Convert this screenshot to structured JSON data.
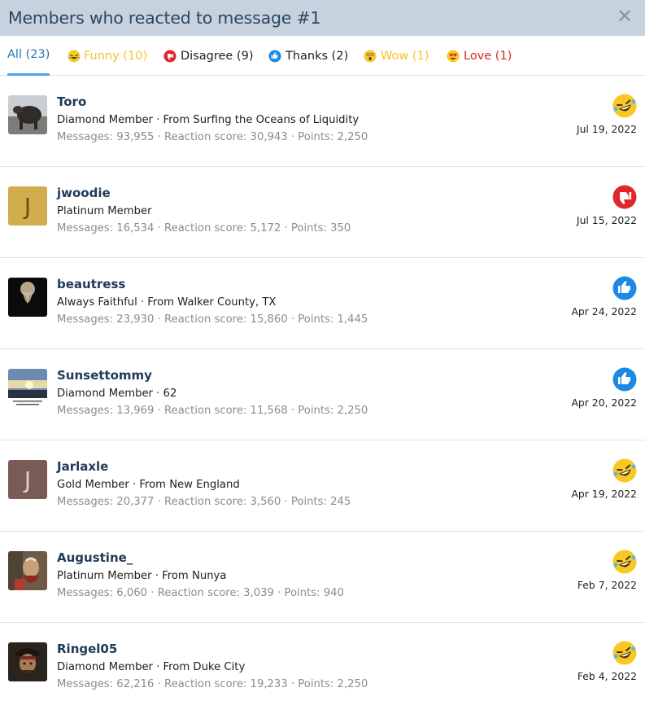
{
  "overlay": {
    "title": "Members who reacted to message #1",
    "close_glyph": "✕"
  },
  "tabs": [
    {
      "label": "All (23)",
      "icon": "",
      "color": "#2577b1"
    },
    {
      "label": "Funny (10)",
      "icon": "funny-icon",
      "color": "#f5c22d"
    },
    {
      "label": "Disagree (9)",
      "icon": "disagree-icon",
      "color": "#1e1e1e"
    },
    {
      "label": "Thanks (2)",
      "icon": "thanks-icon",
      "color": "#1e1e1e"
    },
    {
      "label": "Wow (1)",
      "icon": "wow-icon",
      "color": "#f5c22d"
    },
    {
      "label": "Love (1)",
      "icon": "love-icon",
      "color": "#d9262c"
    }
  ],
  "members": [
    {
      "name": "Toro",
      "title": "Diamond Member · From Surfing the Oceans of Liquidity",
      "stats": "Messages: 93,955 · Reaction score: 30,943 · Points: 2,250",
      "reaction": "funny-icon",
      "date": "Jul 19, 2022",
      "avatar_letter": ""
    },
    {
      "name": "jwoodie",
      "title": "Platinum Member",
      "stats": "Messages: 16,534 · Reaction score: 5,172 · Points: 350",
      "reaction": "disagree-icon",
      "date": "Jul 15, 2022",
      "avatar_letter": "J"
    },
    {
      "name": "beautress",
      "title": "Always Faithful · From Walker County, TX",
      "stats": "Messages: 23,930 · Reaction score: 15,860 · Points: 1,445",
      "reaction": "thanks-icon",
      "date": "Apr 24, 2022",
      "avatar_letter": ""
    },
    {
      "name": "Sunsettommy",
      "title": "Diamond Member · 62",
      "stats": "Messages: 13,969 · Reaction score: 11,568 · Points: 2,250",
      "reaction": "thanks-icon",
      "date": "Apr 20, 2022",
      "avatar_letter": ""
    },
    {
      "name": "Jarlaxle",
      "title": "Gold Member · From New England",
      "stats": "Messages: 20,377 · Reaction score: 3,560 · Points: 245",
      "reaction": "funny-icon",
      "date": "Apr 19, 2022",
      "avatar_letter": "J"
    },
    {
      "name": "Augustine_",
      "title": "Platinum Member · From Nunya",
      "stats": "Messages: 6,060 · Reaction score: 3,039 · Points: 940",
      "reaction": "funny-icon",
      "date": "Feb 7, 2022",
      "avatar_letter": ""
    },
    {
      "name": "Ringel05",
      "title": "Diamond Member · From Duke City",
      "stats": "Messages: 62,216 · Reaction score: 19,233 · Points: 2,250",
      "reaction": "funny-icon",
      "date": "Feb 4, 2022",
      "avatar_letter": ""
    }
  ],
  "colors": {
    "header_bg": "#c6d3df",
    "header_text": "#2b4661",
    "accent": "#47a7eb",
    "username": "#1f3a57",
    "muted": "#8c8c8c"
  }
}
